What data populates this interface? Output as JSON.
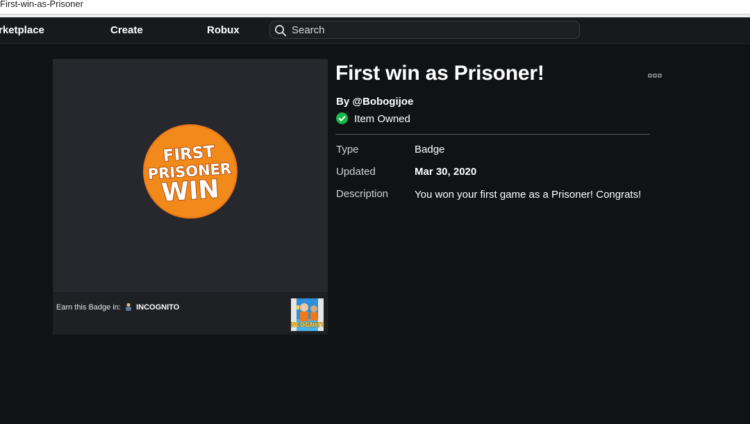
{
  "window": {
    "title": "First-win-as-Prisoner"
  },
  "nav": {
    "items": [
      {
        "label": "rketplace"
      },
      {
        "label": "Create"
      },
      {
        "label": "Robux"
      }
    ],
    "search": {
      "placeholder": "Search",
      "icon": "search-icon"
    }
  },
  "item": {
    "title": "First win as Prisoner!",
    "creator_prefix": "By",
    "creator": "@Bobogijoe",
    "owned_status": "Item Owned",
    "owned_color": "#16b84a",
    "more_icon": "more-options-icon",
    "badge_art": {
      "line1": "FIRST",
      "line2": "PRISONER",
      "line3": "WIN",
      "color": "#f28a1b"
    }
  },
  "details": {
    "type_label": "Type",
    "type_value": "Badge",
    "updated_label": "Updated",
    "updated_value": "Mar 30, 2020",
    "description_label": "Description",
    "description_value": "You won your first game as a Prisoner! Congrats!"
  },
  "earn": {
    "prefix": "Earn this Badge in:",
    "game_name": "INCOGNITO",
    "thumb_text": "INCOGNITO"
  }
}
